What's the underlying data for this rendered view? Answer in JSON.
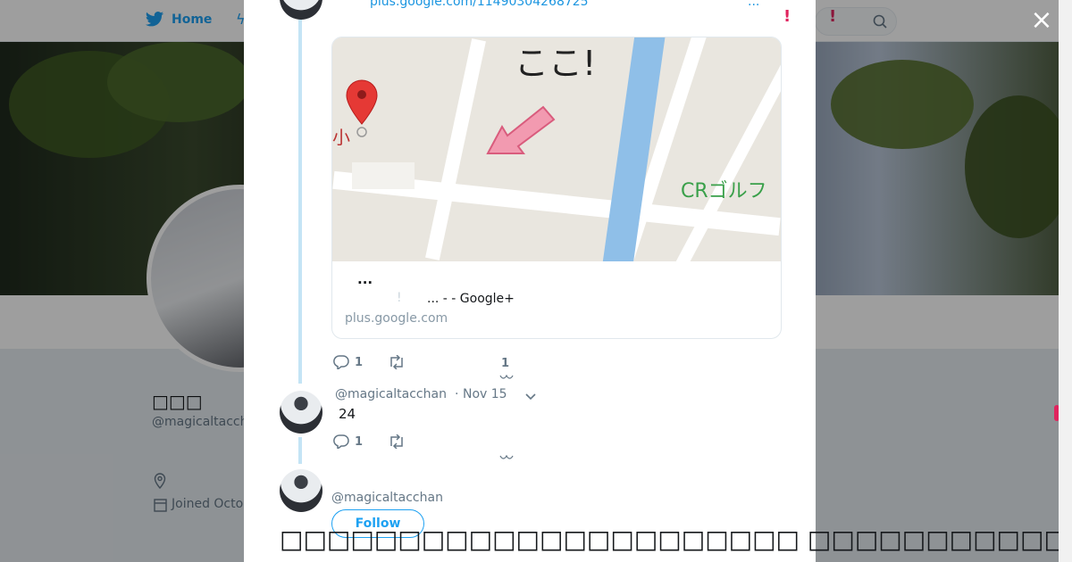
{
  "nav": {
    "home_label": "Home",
    "alert": "!"
  },
  "profile": {
    "name": "□□□",
    "handle": "@magicaltacchan",
    "joined": "Joined Octo"
  },
  "modal": {
    "top_link": "plus.google.com/11490304268725",
    "top_dots": "...",
    "top_alert": "!",
    "card": {
      "map_text": "ここ!",
      "map_label": "CRゴルフ",
      "map_small": "小",
      "title": "...",
      "mark": "!",
      "description": "... -  - Google+",
      "domain": "plus.google.com"
    },
    "tweet1_actions": {
      "reply_count": "1",
      "like_count": "1"
    },
    "tweet2": {
      "handle": "@magicaltacchan",
      "separator": "·",
      "date": "Nov 15",
      "text": "24",
      "reply_count": "1"
    },
    "reply_box": {
      "handle": "@magicaltacchan",
      "follow_label": "Follow"
    },
    "bottom_text": "□□□□□□□□□□□□□□□□□□□□□□ □□□□□□□□□□□□□□□□ □□□□□□□□□□□"
  },
  "close_label": "×",
  "colors": {
    "accent": "#1da1f2",
    "alert": "#e0245e",
    "thread": "#c4e4f5"
  }
}
